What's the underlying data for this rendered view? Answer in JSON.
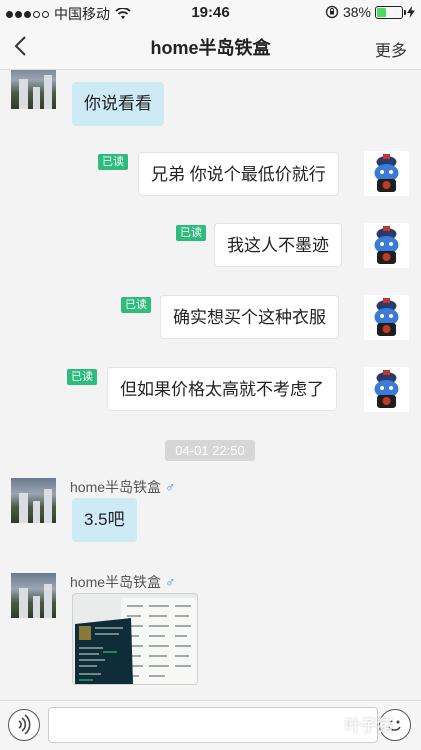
{
  "status_bar": {
    "carrier": "中国移动",
    "time": "19:46",
    "battery": "38%",
    "battery_level": 0.38
  },
  "navbar": {
    "title": "home半岛铁盒",
    "more": "更多"
  },
  "messages": {
    "m1": {
      "text": "你说看看"
    },
    "m2": {
      "read": "已读",
      "text": "兄弟 你说个最低价就行"
    },
    "m3": {
      "read": "已读",
      "text": "我这人不墨迹"
    },
    "m4": {
      "read": "已读",
      "text": "确实想买个这种衣服"
    },
    "m5": {
      "read": "已读",
      "text": "但如果价格太高就不考虑了"
    },
    "timestamp": "04-01 22:50",
    "m6": {
      "name": "home半岛铁盒",
      "gender": "♂",
      "text": "3.5吧"
    },
    "m7": {
      "name": "home半岛铁盒",
      "gender": "♂"
    }
  },
  "input_bar": {
    "watermark": "叶子猪"
  },
  "colors": {
    "incoming_bubble": "#cdeaf5",
    "outgoing_bubble": "#ffffff",
    "read_badge": "#2dbb7e",
    "male_symbol": "#3a8ee6"
  }
}
